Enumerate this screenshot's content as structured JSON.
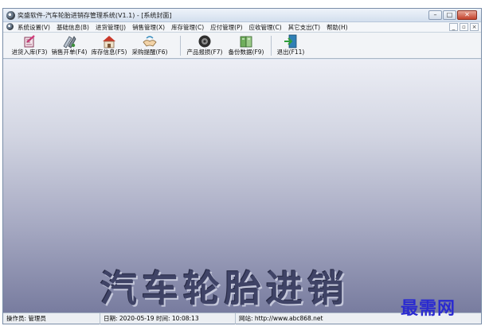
{
  "window": {
    "title": "奕盛软件-汽车轮胎进销存管理系统(V1.1) - [系统封面]",
    "controls": {
      "minimize": "–",
      "maximize": "□",
      "close": "✕"
    }
  },
  "menubar": {
    "items": [
      {
        "label": "系统设置(V)"
      },
      {
        "label": "基础信息(B)"
      },
      {
        "label": "进货管理(J)"
      },
      {
        "label": "销售管理(X)"
      },
      {
        "label": "库存管理(C)"
      },
      {
        "label": "应付管理(P)"
      },
      {
        "label": "应收管理(C)"
      },
      {
        "label": "其它支出(T)"
      },
      {
        "label": "帮助(H)"
      }
    ],
    "mdi_controls": {
      "minimize": "_",
      "restore": "▫",
      "close": "×"
    }
  },
  "toolbar": {
    "buttons": [
      {
        "label": "进货入库(F3)",
        "icon": "stock-in-icon"
      },
      {
        "label": "销售开单(F4)",
        "icon": "sales-order-icon"
      },
      {
        "label": "库存信息(F5)",
        "icon": "warehouse-icon"
      },
      {
        "label": "采购提醒(F6)",
        "icon": "purchase-reminder-icon"
      },
      {
        "label": "产品报损(F7)",
        "icon": "product-damage-icon"
      },
      {
        "label": "备份数据(F9)",
        "icon": "backup-icon"
      },
      {
        "label": "退出(F11)",
        "icon": "exit-icon"
      }
    ]
  },
  "main": {
    "banner_text": "汽车轮胎进销"
  },
  "statusbar": {
    "operator": "操作员: 管理员",
    "date": "日期: 2020-05-19",
    "time": "时间: 10:08:13",
    "website": "网站: http://www.abc868.net"
  },
  "watermark": "最需网",
  "colors": {
    "accent": "#2a2ad0",
    "banner": "#3f4366",
    "close_button": "#c3422c"
  }
}
